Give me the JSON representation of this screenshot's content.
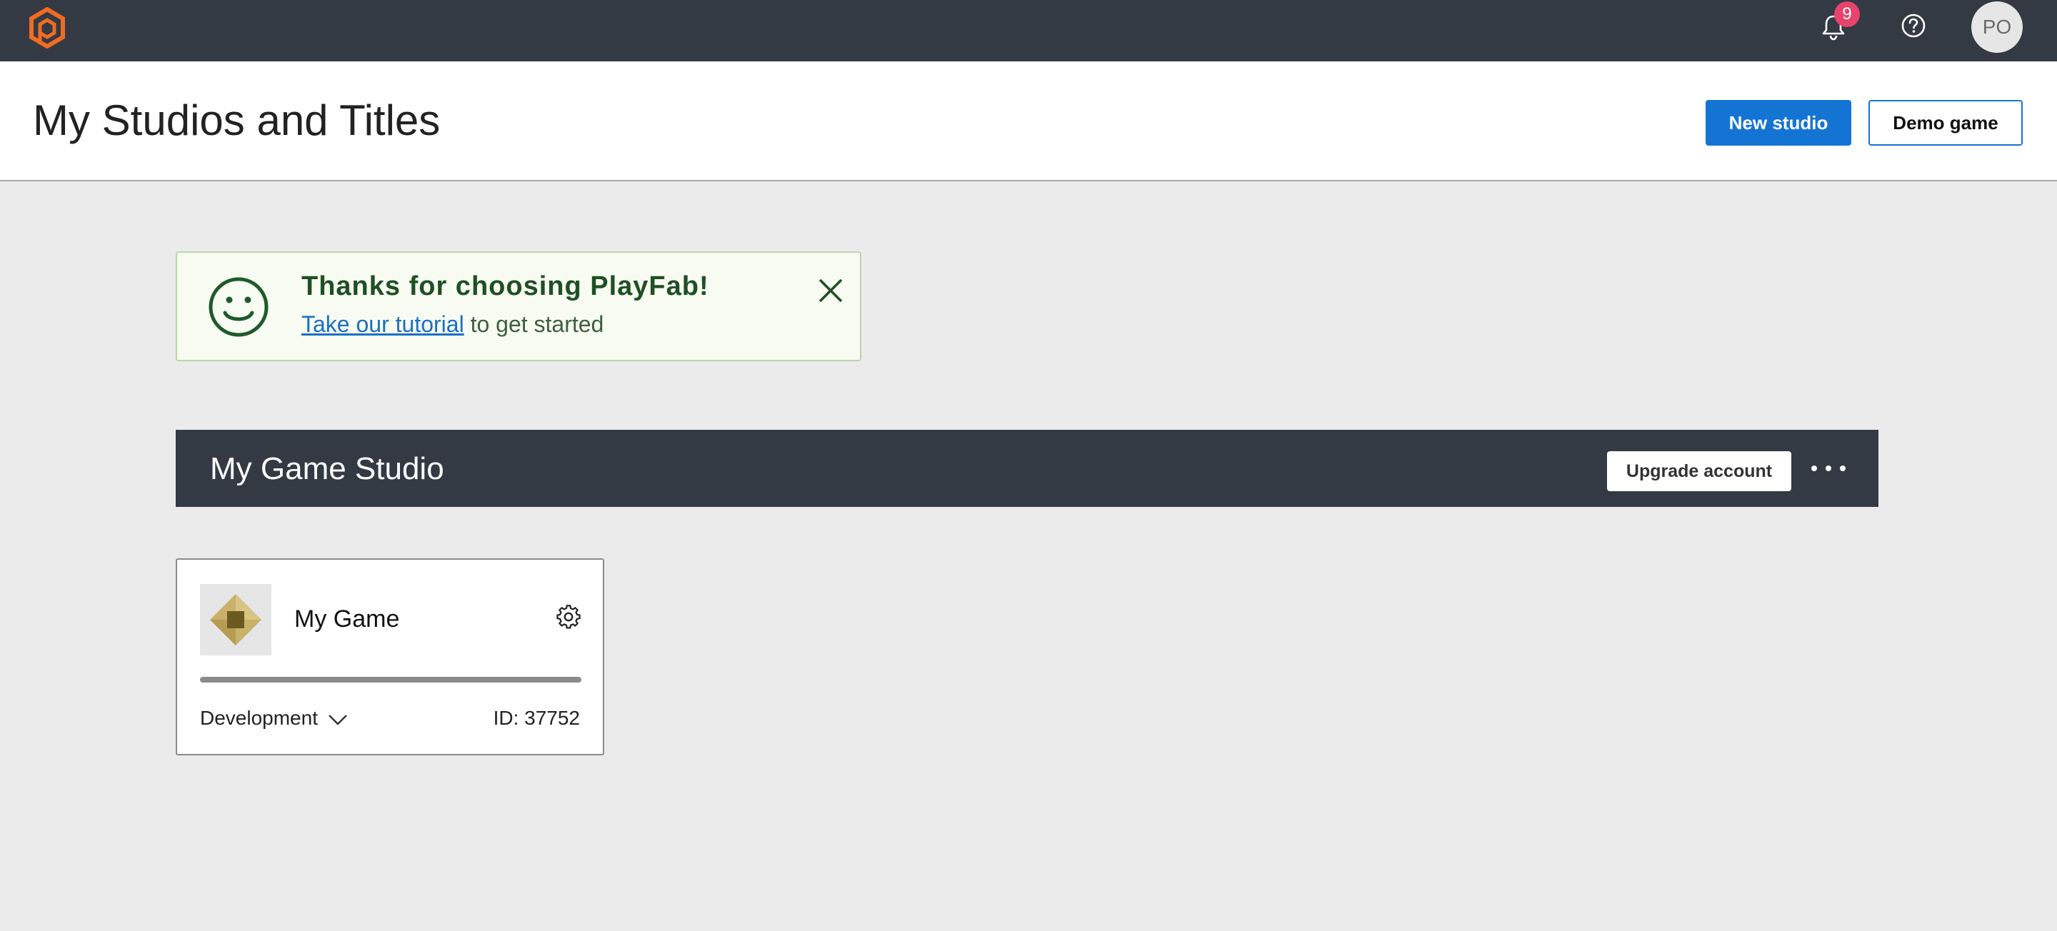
{
  "topbar": {
    "notification_count": "9",
    "avatar_initials": "PO",
    "brand_color": "#f26b21"
  },
  "header": {
    "title": "My Studios and Titles",
    "new_studio_label": "New studio",
    "demo_game_label": "Demo game"
  },
  "banner": {
    "title": "Thanks for choosing PlayFab!",
    "link_text": "Take our tutorial",
    "rest_text": " to get started"
  },
  "studio": {
    "name": "My Game Studio",
    "upgrade_label": "Upgrade account"
  },
  "title_card": {
    "name": "My Game",
    "environment": "Development",
    "id_label": "ID: 37752"
  },
  "colors": {
    "accent": "#1474d4",
    "topbar": "#333a44",
    "badge": "#e8436b",
    "banner_bg": "#f7fbf1",
    "banner_text": "#1f4f24"
  }
}
